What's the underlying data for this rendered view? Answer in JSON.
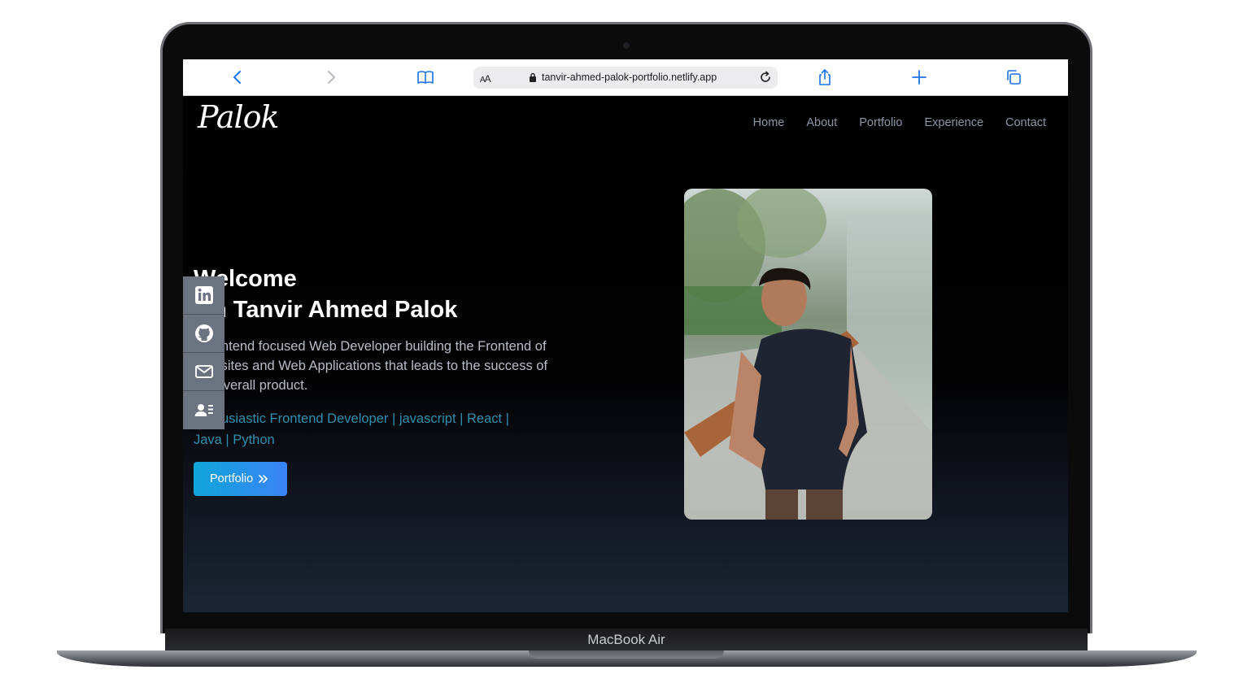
{
  "browser": {
    "url": "tanvir-ahmed-palok-portfolio.netlify.app",
    "reader_small": "A",
    "reader_big": "A"
  },
  "device": {
    "label": "MacBook Air"
  },
  "site": {
    "logo": "Palok",
    "nav": [
      "Home",
      "About",
      "Portfolio",
      "Experience",
      "Contact"
    ],
    "hero": {
      "title_line1": "Welcome",
      "title_line2": "I'm Tanvir Ahmed Palok",
      "description": "A frontend focused Web Developer building the Frontend of Websites and Web Applications that leads to the success of the overall product.",
      "typed_text": "Enthusiastic Frontend Developer | javascript | React | Java | Python",
      "button_label": "Portfolio"
    },
    "social_icons": [
      "linkedin-icon",
      "github-icon",
      "mail-icon",
      "resume-icon"
    ]
  },
  "colors": {
    "accent": "#0fa6d9",
    "typed_text": "#2f8fae",
    "nav_text": "#8b95a6",
    "social_bar": "#6b7280"
  }
}
